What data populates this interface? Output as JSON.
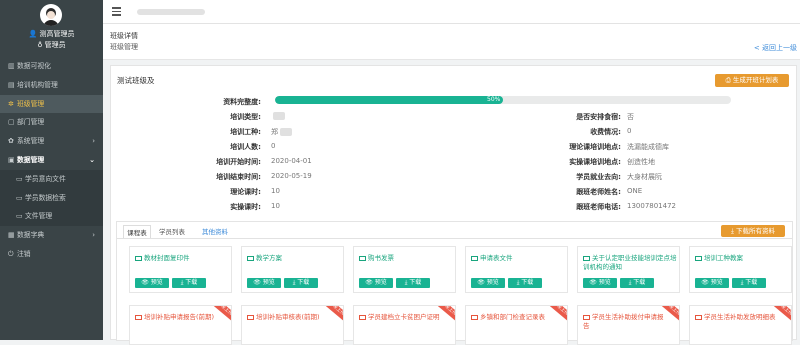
{
  "user": {
    "name": "测高管理员",
    "role": "管理员"
  },
  "menu": [
    {
      "label": "数据可视化",
      "icon": "chart-icon"
    },
    {
      "label": "培训机构管理",
      "icon": "building-icon"
    },
    {
      "label": "班级管理",
      "icon": "gear-icon",
      "active": true
    },
    {
      "label": "部门管理",
      "icon": "folder-icon"
    },
    {
      "label": "系统管理",
      "icon": "settings-icon",
      "arrow": "›"
    },
    {
      "label": "数据管理",
      "icon": "folder-icon",
      "arrow": "⌄"
    },
    {
      "label": "学员意向文件",
      "icon": "folder-icon"
    },
    {
      "label": "学员数据检索",
      "icon": "folder-icon"
    },
    {
      "label": "文件管理",
      "icon": "folder-icon"
    },
    {
      "label": "数据字典",
      "icon": "book-icon",
      "arrow": "›"
    },
    {
      "label": "注销",
      "icon": "power-icon"
    }
  ],
  "header": {
    "title": "班级详情",
    "breadcrumb": "班级管理",
    "back": "< 返回上一级"
  },
  "card": {
    "title": "测试班级及",
    "generate_button": "生成开班计划表",
    "progress": {
      "label": "资料完整度:",
      "percent": 50,
      "text": "50%"
    },
    "left_fields": [
      {
        "label": "培训类型:",
        "value": "",
        "blurred": true
      },
      {
        "label": "培训工种:",
        "value": "郑",
        "blurred": true
      },
      {
        "label": "培训人数:",
        "value": "0"
      },
      {
        "label": "培训开始时间:",
        "value": "2020-04-01"
      },
      {
        "label": "培训结束时间:",
        "value": "2020-05-19"
      },
      {
        "label": "理论课时:",
        "value": "10"
      },
      {
        "label": "实操课时:",
        "value": "10"
      }
    ],
    "right_fields": [
      {
        "label": "是否安排食宿:",
        "value": "否"
      },
      {
        "label": "收费情况:",
        "value": "0"
      },
      {
        "label": "理论课培训地点:",
        "value": "洗漏能成德库"
      },
      {
        "label": "实操课培训地点:",
        "value": "创造性地"
      },
      {
        "label": "学员就业去向:",
        "value": "大身材展阮"
      },
      {
        "label": "跟班老师姓名:",
        "value": "ONE"
      },
      {
        "label": "跟班老师电话:",
        "value": "13007801472"
      }
    ]
  },
  "tabs": [
    "课程表",
    "学员列表",
    "其他资料"
  ],
  "download_all": "下载所有资料",
  "doc_buttons": {
    "preview": "👁 预览",
    "download": "⤓ 下载"
  },
  "docs": [
    "教材封面复印件",
    "教学方案",
    "购书发票",
    "申请表文件",
    "关于认定职业技能培训定点培训机构的通知",
    "培训工种教案"
  ],
  "docs_missing": [
    "培训补贴申请报告(前期)",
    "培训补贴审核表(前期)",
    "学员建档立卡贫困户证明",
    "乡镇和部门检查记录表",
    "学员生活补助拨付申请报告",
    "学员生活补助发放明细表"
  ],
  "missing_tag": "未上传",
  "colors": {
    "sidebar": "#3a4447",
    "active": "#f1c24a",
    "green": "#19b393",
    "orange": "#e79a2f",
    "red": "#e6553c"
  }
}
